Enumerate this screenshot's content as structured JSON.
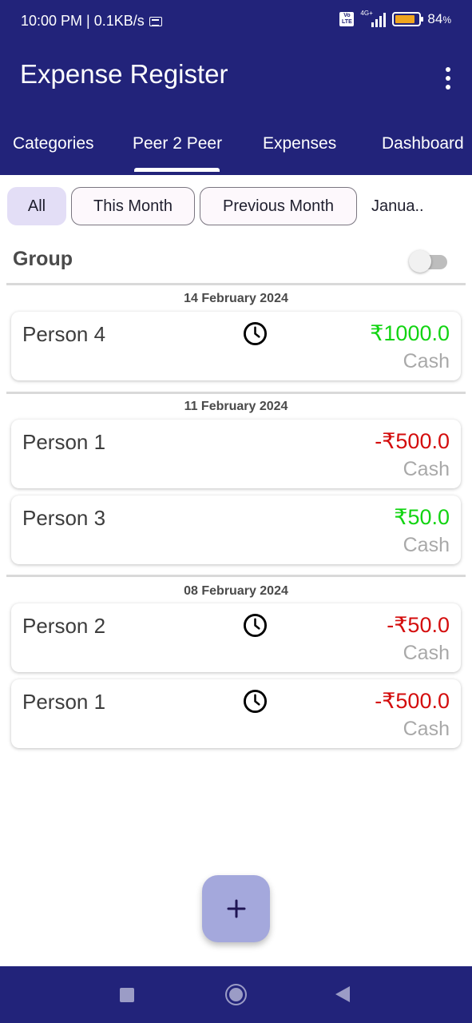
{
  "status_bar": {
    "time_speed": "10:00 PM | 0.1KB/s",
    "volte": "Vo LTE",
    "network": "4G+",
    "battery_pct": "84",
    "battery_unit": "%",
    "battery_level": 0.84
  },
  "app_bar": {
    "title": "Expense Register"
  },
  "tabs": [
    {
      "label": "Categories"
    },
    {
      "label": "Peer 2 Peer",
      "selected": true
    },
    {
      "label": "Expenses"
    },
    {
      "label": "Dashboard"
    }
  ],
  "filters": [
    {
      "label": "All",
      "selected": true
    },
    {
      "label": "This Month"
    },
    {
      "label": "Previous Month"
    },
    {
      "label": "Janua.."
    }
  ],
  "group": {
    "label": "Group",
    "enabled": false
  },
  "sections": [
    {
      "date": "14 February 2024",
      "entries": [
        {
          "name": "Person 4",
          "amount": "₹1000.0",
          "method": "Cash",
          "pending": true,
          "type": "positive"
        }
      ]
    },
    {
      "date": "11 February 2024",
      "entries": [
        {
          "name": "Person 1",
          "amount": "-₹500.0",
          "method": "Cash",
          "pending": false,
          "type": "negative"
        },
        {
          "name": "Person 3",
          "amount": "₹50.0",
          "method": "Cash",
          "pending": false,
          "type": "positive"
        }
      ]
    },
    {
      "date": "08 February 2024",
      "entries": [
        {
          "name": "Person 2",
          "amount": "-₹50.0",
          "method": "Cash",
          "pending": true,
          "type": "negative"
        },
        {
          "name": "Person 1",
          "amount": "-₹500.0",
          "method": "Cash",
          "pending": true,
          "type": "negative"
        }
      ]
    }
  ],
  "colors": {
    "primary": "#22237a",
    "positive": "#12d412",
    "negative": "#d40d0d",
    "fab": "#a4a8dc"
  },
  "icons": {
    "fab": "plus-icon",
    "pending": "clock-icon",
    "menu": "overflow-menu-icon"
  }
}
